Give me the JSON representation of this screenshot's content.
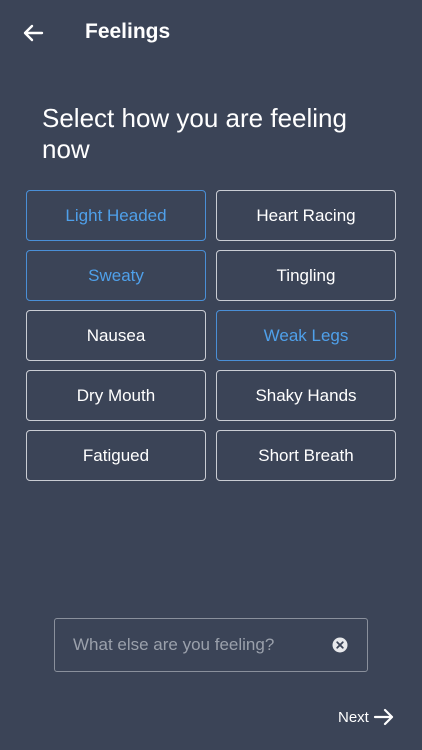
{
  "header": {
    "title": "Feelings",
    "back_icon": "arrow-left-icon"
  },
  "prompt": "Select how you are feeling now",
  "feelings": [
    {
      "label": "Light Headed",
      "selected": true
    },
    {
      "label": "Heart Racing",
      "selected": false
    },
    {
      "label": "Sweaty",
      "selected": true
    },
    {
      "label": "Tingling",
      "selected": false
    },
    {
      "label": "Nausea",
      "selected": false
    },
    {
      "label": "Weak Legs",
      "selected": true
    },
    {
      "label": "Dry Mouth",
      "selected": false
    },
    {
      "label": "Shaky Hands",
      "selected": false
    },
    {
      "label": "Fatigued",
      "selected": false
    },
    {
      "label": "Short Breath",
      "selected": false
    }
  ],
  "input": {
    "value": "",
    "placeholder": "What else are you feeling?",
    "clear_icon": "clear-circle-icon"
  },
  "next": {
    "label": "Next",
    "icon": "arrow-right-icon"
  },
  "colors": {
    "background": "#3b4457",
    "accent": "#4fa0ea",
    "border": "#c9ccd3"
  }
}
